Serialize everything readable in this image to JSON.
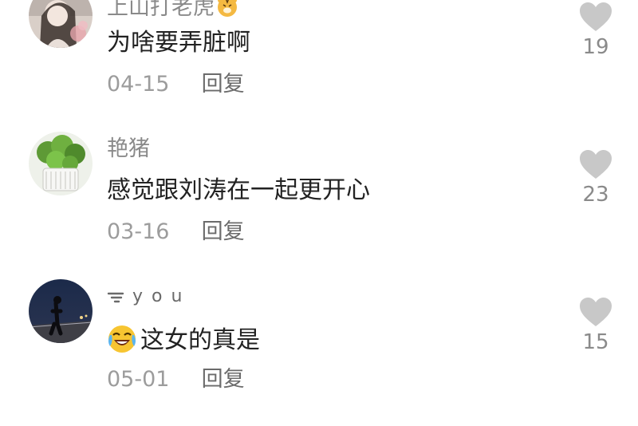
{
  "comments": [
    {
      "username": "上山打老虎",
      "badge_icon": "tiger-emoji",
      "text": "为啥要弄脏啊",
      "date": "04-15",
      "reply_label": "回复",
      "likes": "19"
    },
    {
      "username": "艳猪",
      "text": "感觉跟刘涛在一起更开心",
      "date": "03-16",
      "reply_label": "回复",
      "likes": "23"
    },
    {
      "username": "y o u",
      "name_icon": "wifi-signal-icon",
      "text_emoji": "crying-laughing-emoji",
      "text": "这女的真是",
      "date": "05-01",
      "reply_label": "回复",
      "likes": "15"
    }
  ],
  "colors": {
    "heart": "#c8c8c8",
    "username": "#8a8a8a",
    "text": "#222222",
    "date": "#9c9c9c"
  }
}
